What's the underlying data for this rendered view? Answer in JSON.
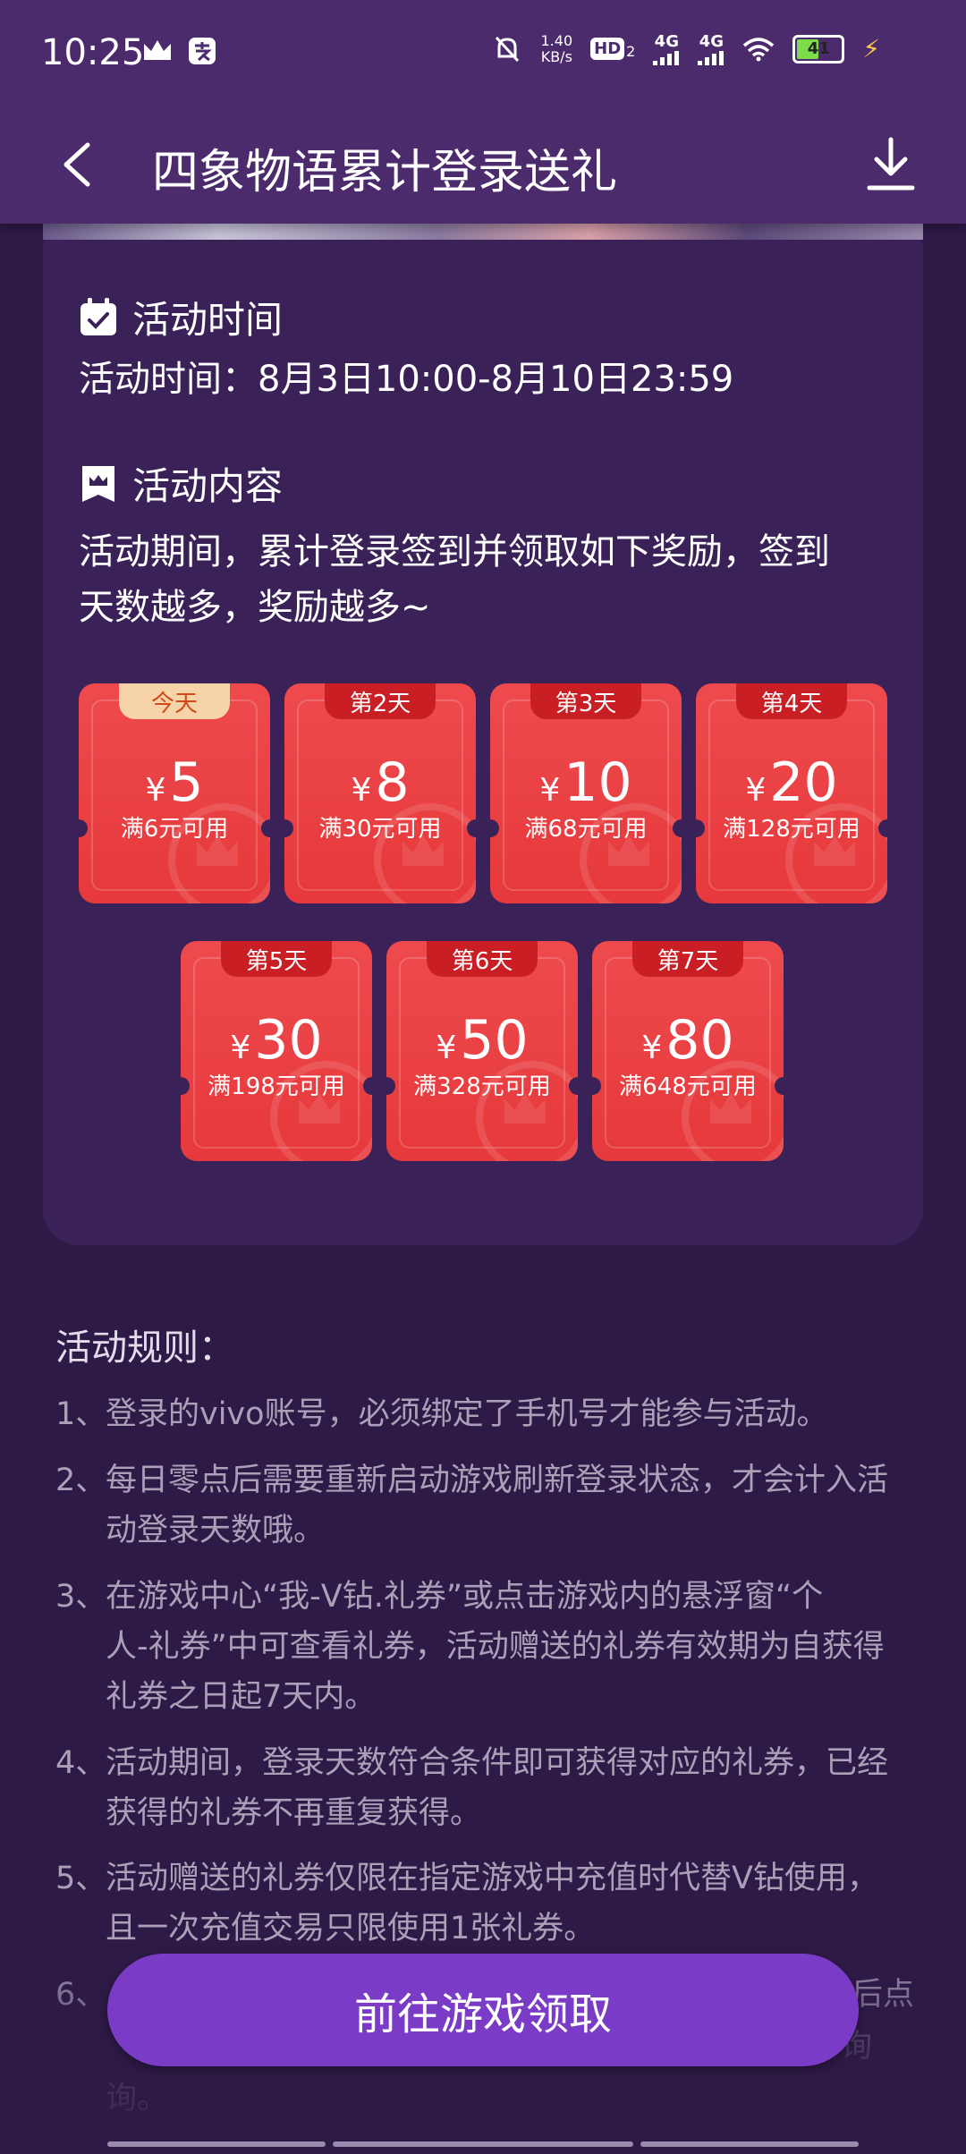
{
  "status_bar": {
    "time": "10:25",
    "speed_value": "1.40",
    "speed_unit": "KB/s",
    "hd": "HD",
    "hd_sub": "2",
    "signal1": "4G",
    "signal2": "4G",
    "battery": "41",
    "icons": [
      "crown-icon",
      "pay-icon",
      "silent-bell-icon",
      "hd-icon",
      "signal-icon",
      "wifi-icon",
      "battery-icon",
      "charging-icon"
    ]
  },
  "header": {
    "title": "四象物语累计登录送礼",
    "back_icon": "back-arrow-icon",
    "download_icon": "download-icon"
  },
  "activity_time": {
    "heading": "活动时间",
    "text": "活动时间：8月3日10:00-8月10日23:59"
  },
  "activity_content": {
    "heading": "活动内容",
    "line1": "活动期间，累计登录签到并领取如下奖励，签到",
    "line2": "天数越多，奖励越多~"
  },
  "coupons": [
    {
      "day": "今天",
      "amount": "5",
      "condition": "满6元可用"
    },
    {
      "day": "第2天",
      "amount": "8",
      "condition": "满30元可用"
    },
    {
      "day": "第3天",
      "amount": "10",
      "condition": "满68元可用"
    },
    {
      "day": "第4天",
      "amount": "20",
      "condition": "满128元可用"
    },
    {
      "day": "第5天",
      "amount": "30",
      "condition": "满198元可用"
    },
    {
      "day": "第6天",
      "amount": "50",
      "condition": "满328元可用"
    },
    {
      "day": "第7天",
      "amount": "80",
      "condition": "满648元可用"
    }
  ],
  "currency_symbol": "¥",
  "rules": {
    "title": "活动规则：",
    "r1_num": "1、",
    "r1_l1": "登录的vivo账号，必须绑定了手机号才能参与活动。",
    "r2_num": "2、",
    "r2_l1": "每日零点后需要重新启动游戏刷新登录状态，才会计入活",
    "r2_l2": "动登录天数哦。",
    "r3_num": "3、",
    "r3_l1": "在游戏中心“我-V钻.礼券”或点击游戏内的悬浮窗“个",
    "r3_l2": "人-礼券”中可查看礼券，活动赠送的礼券有效期为自获得",
    "r3_l3": "礼券之日起7天内。",
    "r4_num": "4、",
    "r4_l1": "活动期间，登录天数符合条件即可获得对应的礼券，已经",
    "r4_l2": "获得的礼券不再重复获得。",
    "r5_num": "5、",
    "r5_l1": "活动赠送的礼券仅限在指定游戏中充值时代替V钻使用，",
    "r5_l2": "且一次充值交易只限使用1张礼券。",
    "r6_num": "6、",
    "r6_tail": "后点",
    "r6_l2_tail": "询",
    "r6_l3": "询。"
  },
  "cta_label": "前往游戏领取",
  "colors": {
    "background": "#2e1a47",
    "header": "#4c2b6c",
    "card": "#3a2258",
    "coupon": "#e6393b",
    "cta": "#7a3bc7"
  }
}
